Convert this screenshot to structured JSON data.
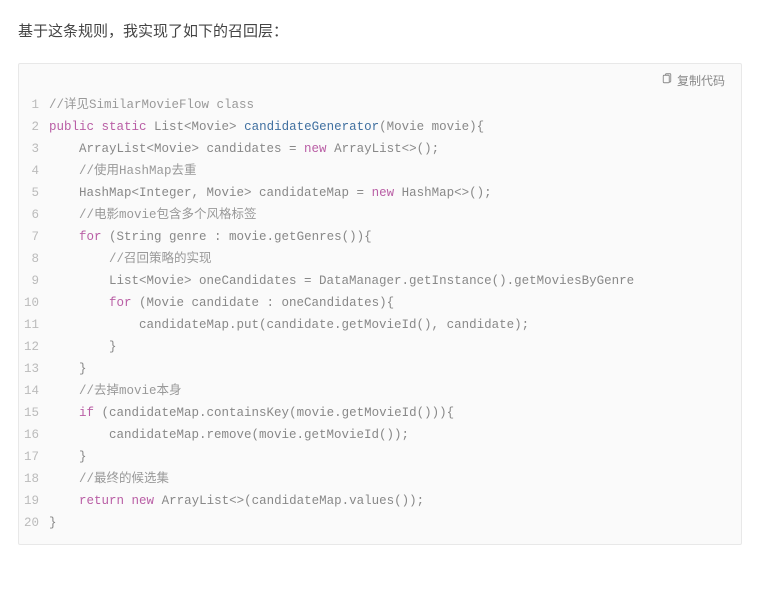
{
  "intro": "基于这条规则，我实现了如下的召回层：",
  "copy_label": "复制代码",
  "lines": [
    {
      "n": "1",
      "tokens": [
        {
          "t": "//详见SimilarMovieFlow class",
          "c": "cm"
        }
      ]
    },
    {
      "n": "2",
      "tokens": [
        {
          "t": "public",
          "c": "kw"
        },
        {
          "t": " ",
          "c": "pl"
        },
        {
          "t": "static",
          "c": "kw"
        },
        {
          "t": " List<Movie> ",
          "c": "pl"
        },
        {
          "t": "candidateGenerator",
          "c": "fn"
        },
        {
          "t": "(Movie movie){",
          "c": "pl"
        }
      ]
    },
    {
      "n": "3",
      "tokens": [
        {
          "t": "    ArrayList<Movie> candidates = ",
          "c": "pl"
        },
        {
          "t": "new",
          "c": "kw"
        },
        {
          "t": " ArrayList<>();",
          "c": "pl"
        }
      ]
    },
    {
      "n": "4",
      "tokens": [
        {
          "t": "    ",
          "c": "pl"
        },
        {
          "t": "//使用HashMap去重",
          "c": "cm"
        }
      ]
    },
    {
      "n": "5",
      "tokens": [
        {
          "t": "    HashMap<Integer, Movie> candidateMap = ",
          "c": "pl"
        },
        {
          "t": "new",
          "c": "kw"
        },
        {
          "t": " HashMap<>();",
          "c": "pl"
        }
      ]
    },
    {
      "n": "6",
      "tokens": [
        {
          "t": "    ",
          "c": "pl"
        },
        {
          "t": "//电影movie包含多个风格标签",
          "c": "cm"
        }
      ]
    },
    {
      "n": "7",
      "tokens": [
        {
          "t": "    ",
          "c": "pl"
        },
        {
          "t": "for",
          "c": "kw"
        },
        {
          "t": " (String genre : movie.getGenres()){",
          "c": "pl"
        }
      ]
    },
    {
      "n": "8",
      "tokens": [
        {
          "t": "        ",
          "c": "pl"
        },
        {
          "t": "//召回策略的实现",
          "c": "cm"
        }
      ]
    },
    {
      "n": "9",
      "tokens": [
        {
          "t": "        List<Movie> oneCandidates = DataManager.getInstance().getMoviesByGenre",
          "c": "pl"
        }
      ]
    },
    {
      "n": "10",
      "tokens": [
        {
          "t": "        ",
          "c": "pl"
        },
        {
          "t": "for",
          "c": "kw"
        },
        {
          "t": " (Movie candidate : oneCandidates){",
          "c": "pl"
        }
      ]
    },
    {
      "n": "11",
      "tokens": [
        {
          "t": "            candidateMap.put(candidate.getMovieId(), candidate);",
          "c": "pl"
        }
      ]
    },
    {
      "n": "12",
      "tokens": [
        {
          "t": "        }",
          "c": "pl"
        }
      ]
    },
    {
      "n": "13",
      "tokens": [
        {
          "t": "    }",
          "c": "pl"
        }
      ]
    },
    {
      "n": "14",
      "tokens": [
        {
          "t": "    ",
          "c": "pl"
        },
        {
          "t": "//去掉movie本身",
          "c": "cm"
        }
      ]
    },
    {
      "n": "15",
      "tokens": [
        {
          "t": "    ",
          "c": "pl"
        },
        {
          "t": "if",
          "c": "kw"
        },
        {
          "t": " (candidateMap.containsKey(movie.getMovieId())){",
          "c": "pl"
        }
      ]
    },
    {
      "n": "16",
      "tokens": [
        {
          "t": "        candidateMap.remove(movie.getMovieId());",
          "c": "pl"
        }
      ]
    },
    {
      "n": "17",
      "tokens": [
        {
          "t": "    }",
          "c": "pl"
        }
      ]
    },
    {
      "n": "18",
      "tokens": [
        {
          "t": "    ",
          "c": "pl"
        },
        {
          "t": "//最终的候选集",
          "c": "cm"
        }
      ]
    },
    {
      "n": "19",
      "tokens": [
        {
          "t": "    ",
          "c": "pl"
        },
        {
          "t": "return",
          "c": "kw"
        },
        {
          "t": " ",
          "c": "pl"
        },
        {
          "t": "new",
          "c": "kw"
        },
        {
          "t": " ArrayList<>(candidateMap.values());",
          "c": "pl"
        }
      ]
    },
    {
      "n": "20",
      "tokens": [
        {
          "t": "}",
          "c": "pl"
        }
      ]
    }
  ]
}
